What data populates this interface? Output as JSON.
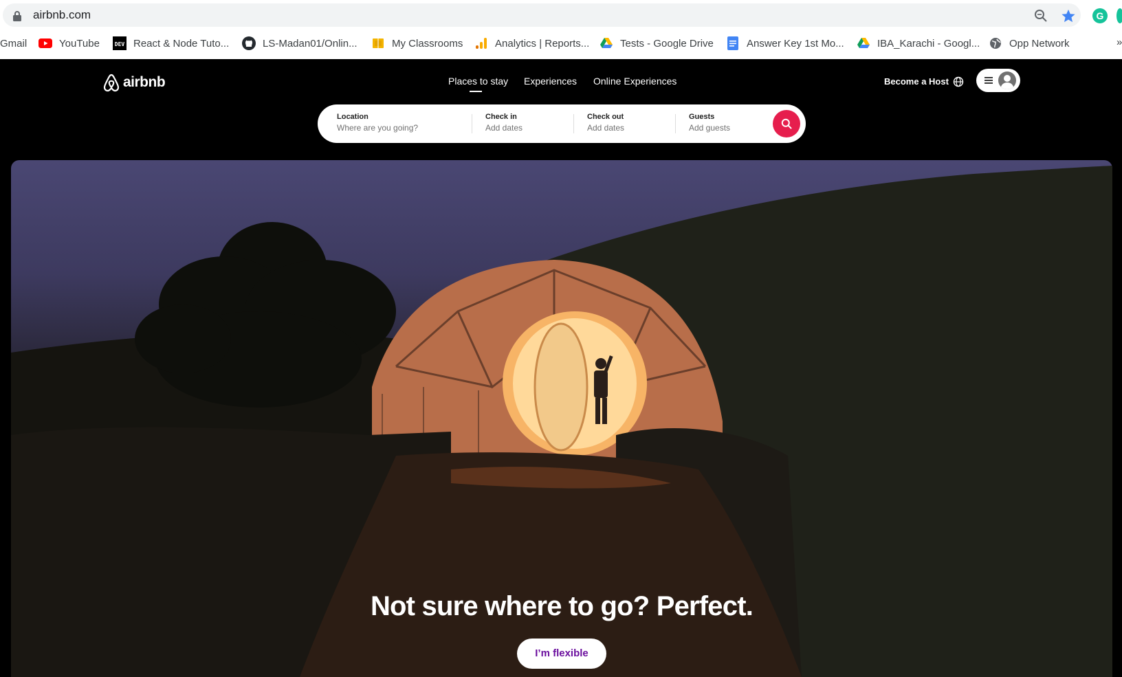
{
  "browser": {
    "url": "airbnb.com",
    "bookmarks": [
      {
        "label": "Gmail",
        "icon": "gmail-icon"
      },
      {
        "label": "YouTube",
        "icon": "youtube-icon"
      },
      {
        "label": "React & Node Tuto...",
        "icon": "dev-icon"
      },
      {
        "label": "LS-Madan01/Onlin...",
        "icon": "github-icon"
      },
      {
        "label": "My Classrooms",
        "icon": "classroom-icon"
      },
      {
        "label": "Analytics | Reports...",
        "icon": "analytics-icon"
      },
      {
        "label": "Tests - Google Drive",
        "icon": "drive-icon"
      },
      {
        "label": "Answer Key 1st Mo...",
        "icon": "docs-icon"
      },
      {
        "label": "IBA_Karachi - Googl...",
        "icon": "drive-icon"
      },
      {
        "label": "Opp Network",
        "icon": "globe-icon"
      }
    ],
    "more": "»",
    "extension_letter": "G"
  },
  "header": {
    "logo_text": "airbnb",
    "nav": [
      {
        "label": "Places to stay",
        "active": true
      },
      {
        "label": "Experiences",
        "active": false
      },
      {
        "label": "Online Experiences",
        "active": false
      }
    ],
    "host_link": "Become a Host"
  },
  "search": {
    "location": {
      "label": "Location",
      "placeholder": "Where are you going?"
    },
    "checkin": {
      "label": "Check in",
      "value": "Add dates"
    },
    "checkout": {
      "label": "Check out",
      "value": "Add dates"
    },
    "guests": {
      "label": "Guests",
      "value": "Add guests"
    }
  },
  "hero": {
    "title": "Not sure where to go? Perfect.",
    "cta": "I’m flexible"
  },
  "colors": {
    "brand": "#FF385C",
    "search_button": "#E61E4D",
    "cta_text": "#6B0F9E"
  }
}
